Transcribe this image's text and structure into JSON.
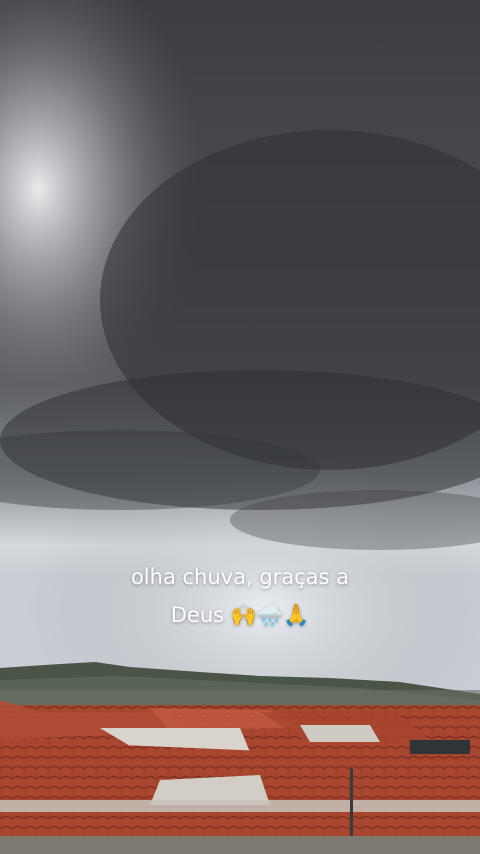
{
  "story": {
    "caption_line1": "olha chuva, graças a",
    "caption_line2": "Deus 🙌🌧️🙏"
  },
  "scene": {
    "description_tags": [
      "storm-clouds",
      "overcast-sky",
      "distant-hills",
      "red-tile-rooftops"
    ],
    "colors": {
      "sky_dark": "#3c3d41",
      "sky_light": "#d9dde2",
      "roof_red": "#b5503a",
      "hills": "#4a5548"
    }
  }
}
